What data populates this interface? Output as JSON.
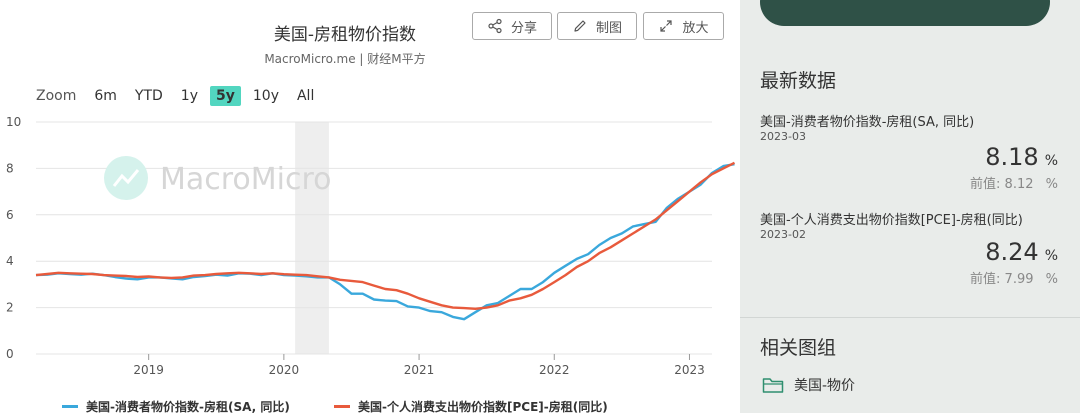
{
  "chart": {
    "title": "美国-房租物价指数",
    "source": "MacroMicro.me | 财经M平方"
  },
  "toolbar": {
    "share_label": "分享",
    "draw_label": "制图",
    "zoom_label": "放大"
  },
  "zoom": {
    "label": "Zoom",
    "options": [
      "6m",
      "YTD",
      "1y",
      "5y",
      "10y",
      "All"
    ],
    "active": "5y"
  },
  "watermark": "MacroMicro",
  "chart_data": {
    "type": "line",
    "title": "美国-房租物价指数",
    "ylim": [
      0,
      10
    ],
    "yticks": [
      0,
      2,
      4,
      6,
      8,
      10
    ],
    "xlim": [
      "2018-03",
      "2023-03"
    ],
    "xticks": [
      "2019",
      "2020",
      "2021",
      "2022",
      "2023"
    ],
    "shaded_period": [
      "2020-02",
      "2020-04"
    ],
    "grid": true,
    "legend": "bottom",
    "series": [
      {
        "name": "美国-消费者物价指数-房租(SA, 同比)",
        "color": "#3aa8dc",
        "points": [
          [
            "2018-03",
            3.4
          ],
          [
            "2018-04",
            3.42
          ],
          [
            "2018-05",
            3.48
          ],
          [
            "2018-06",
            3.45
          ],
          [
            "2018-07",
            3.42
          ],
          [
            "2018-08",
            3.46
          ],
          [
            "2018-09",
            3.4
          ],
          [
            "2018-10",
            3.32
          ],
          [
            "2018-11",
            3.25
          ],
          [
            "2018-12",
            3.22
          ],
          [
            "2019-01",
            3.3
          ],
          [
            "2019-02",
            3.3
          ],
          [
            "2019-03",
            3.26
          ],
          [
            "2019-04",
            3.22
          ],
          [
            "2019-05",
            3.32
          ],
          [
            "2019-06",
            3.36
          ],
          [
            "2019-07",
            3.42
          ],
          [
            "2019-08",
            3.38
          ],
          [
            "2019-09",
            3.48
          ],
          [
            "2019-10",
            3.46
          ],
          [
            "2019-11",
            3.4
          ],
          [
            "2019-12",
            3.48
          ],
          [
            "2020-01",
            3.4
          ],
          [
            "2020-02",
            3.38
          ],
          [
            "2020-03",
            3.35
          ],
          [
            "2020-04",
            3.3
          ],
          [
            "2020-05",
            3.3
          ],
          [
            "2020-06",
            3.0
          ],
          [
            "2020-07",
            2.6
          ],
          [
            "2020-08",
            2.6
          ],
          [
            "2020-09",
            2.35
          ],
          [
            "2020-10",
            2.3
          ],
          [
            "2020-11",
            2.28
          ],
          [
            "2020-12",
            2.05
          ],
          [
            "2021-01",
            2.0
          ],
          [
            "2021-02",
            1.85
          ],
          [
            "2021-03",
            1.8
          ],
          [
            "2021-04",
            1.6
          ],
          [
            "2021-05",
            1.5
          ],
          [
            "2021-06",
            1.8
          ],
          [
            "2021-07",
            2.1
          ],
          [
            "2021-08",
            2.2
          ],
          [
            "2021-09",
            2.5
          ],
          [
            "2021-10",
            2.8
          ],
          [
            "2021-11",
            2.8
          ],
          [
            "2021-12",
            3.1
          ],
          [
            "2022-01",
            3.5
          ],
          [
            "2022-02",
            3.8
          ],
          [
            "2022-03",
            4.1
          ],
          [
            "2022-04",
            4.3
          ],
          [
            "2022-05",
            4.7
          ],
          [
            "2022-06",
            5.0
          ],
          [
            "2022-07",
            5.2
          ],
          [
            "2022-08",
            5.5
          ],
          [
            "2022-09",
            5.6
          ],
          [
            "2022-10",
            5.7
          ],
          [
            "2022-11",
            6.3
          ],
          [
            "2022-12",
            6.7
          ],
          [
            "2023-01",
            7.0
          ],
          [
            "2023-02",
            7.3
          ],
          [
            "2023-03",
            7.8
          ],
          [
            "2023-04",
            8.1
          ],
          [
            "2023-05",
            8.18
          ]
        ]
      },
      {
        "name": "美国-个人消费支出物价指数[PCE]-房租(同比)",
        "color": "#e85a3c",
        "points": [
          [
            "2018-03",
            3.4
          ],
          [
            "2018-04",
            3.45
          ],
          [
            "2018-05",
            3.5
          ],
          [
            "2018-06",
            3.48
          ],
          [
            "2018-07",
            3.46
          ],
          [
            "2018-08",
            3.45
          ],
          [
            "2018-09",
            3.4
          ],
          [
            "2018-10",
            3.38
          ],
          [
            "2018-11",
            3.36
          ],
          [
            "2018-12",
            3.32
          ],
          [
            "2019-01",
            3.34
          ],
          [
            "2019-02",
            3.3
          ],
          [
            "2019-03",
            3.28
          ],
          [
            "2019-04",
            3.3
          ],
          [
            "2019-05",
            3.38
          ],
          [
            "2019-06",
            3.4
          ],
          [
            "2019-07",
            3.45
          ],
          [
            "2019-08",
            3.48
          ],
          [
            "2019-09",
            3.5
          ],
          [
            "2019-10",
            3.48
          ],
          [
            "2019-11",
            3.45
          ],
          [
            "2019-12",
            3.48
          ],
          [
            "2020-01",
            3.44
          ],
          [
            "2020-02",
            3.42
          ],
          [
            "2020-03",
            3.4
          ],
          [
            "2020-04",
            3.35
          ],
          [
            "2020-05",
            3.3
          ],
          [
            "2020-06",
            3.2
          ],
          [
            "2020-07",
            3.15
          ],
          [
            "2020-08",
            3.1
          ],
          [
            "2020-09",
            2.95
          ],
          [
            "2020-10",
            2.8
          ],
          [
            "2020-11",
            2.75
          ],
          [
            "2020-12",
            2.6
          ],
          [
            "2021-01",
            2.4
          ],
          [
            "2021-02",
            2.25
          ],
          [
            "2021-03",
            2.1
          ],
          [
            "2021-04",
            2.0
          ],
          [
            "2021-05",
            1.98
          ],
          [
            "2021-06",
            1.95
          ],
          [
            "2021-07",
            2.0
          ],
          [
            "2021-08",
            2.1
          ],
          [
            "2021-09",
            2.3
          ],
          [
            "2021-10",
            2.4
          ],
          [
            "2021-11",
            2.55
          ],
          [
            "2021-12",
            2.8
          ],
          [
            "2022-01",
            3.1
          ],
          [
            "2022-02",
            3.4
          ],
          [
            "2022-03",
            3.75
          ],
          [
            "2022-04",
            4.0
          ],
          [
            "2022-05",
            4.35
          ],
          [
            "2022-06",
            4.6
          ],
          [
            "2022-07",
            4.9
          ],
          [
            "2022-08",
            5.2
          ],
          [
            "2022-09",
            5.5
          ],
          [
            "2022-10",
            5.8
          ],
          [
            "2022-11",
            6.2
          ],
          [
            "2022-12",
            6.6
          ],
          [
            "2023-01",
            7.0
          ],
          [
            "2023-02",
            7.4
          ],
          [
            "2023-03",
            7.75
          ],
          [
            "2023-04",
            8.0
          ],
          [
            "2023-05",
            8.24
          ]
        ]
      }
    ]
  },
  "side": {
    "heading": "最新数据",
    "items": [
      {
        "name": "美国-消费者物价指数-房租(SA, 同比)",
        "date": "2023-03",
        "value": "8.18",
        "unit": "%",
        "prev_label": "前值: 8.12",
        "prev_unit": "%"
      },
      {
        "name": "美国-个人消费支出物价指数[PCE]-房租(同比)",
        "date": "2023-02",
        "value": "8.24",
        "unit": "%",
        "prev_label": "前值: 7.99",
        "prev_unit": "%"
      }
    ],
    "related_heading": "相关图组",
    "related_item": "美国-物价"
  },
  "colors": {
    "accent": "#52d6c0",
    "cpi_line": "#3aa8dc",
    "pce_line": "#e85a3c",
    "side_bg": "#e9ecea"
  }
}
